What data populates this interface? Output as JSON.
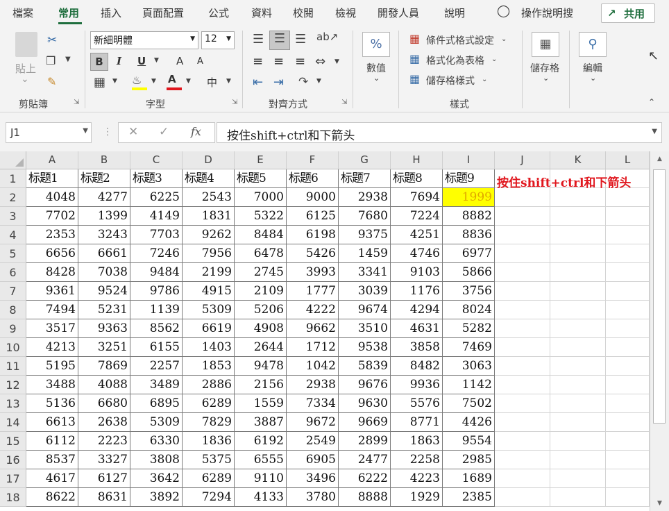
{
  "menu": {
    "tabs": [
      "檔案",
      "常用",
      "插入",
      "頁面配置",
      "公式",
      "資料",
      "校閱",
      "檢視",
      "開發人員",
      "說明"
    ],
    "active_tab": "常用",
    "search_label": "操作說明搜",
    "share_label": "共用"
  },
  "ribbon": {
    "clipboard": {
      "paste_label": "貼上",
      "group_label": "剪貼簿"
    },
    "font": {
      "font_name": "新細明體",
      "font_size": "12",
      "bold": "B",
      "italic": "I",
      "underline": "U",
      "grow": "A",
      "shrink": "A",
      "font_color_letter": "A",
      "phonetic": "中",
      "group_label": "字型"
    },
    "alignment": {
      "group_label": "對齊方式"
    },
    "number": {
      "label": "數值",
      "symbol": "%"
    },
    "styles": {
      "conditional": "條件式格式設定",
      "format_table": "格式化為表格",
      "cell_styles": "儲存格樣式",
      "group_label": "樣式"
    },
    "cells": {
      "label": "儲存格"
    },
    "editing": {
      "label": "編輯"
    }
  },
  "formula_bar": {
    "name_box": "J1",
    "fx": "fx",
    "content": "按住shift+ctrl和下箭头"
  },
  "sheet": {
    "columns": [
      "A",
      "B",
      "C",
      "D",
      "E",
      "F",
      "G",
      "H",
      "I",
      "J",
      "K",
      "L"
    ],
    "rows": [
      "1",
      "2",
      "3",
      "4",
      "5",
      "6",
      "7",
      "8",
      "9",
      "10",
      "11",
      "12",
      "13",
      "14",
      "15",
      "16",
      "17",
      "18"
    ],
    "headers": [
      "标题1",
      "标题2",
      "标题3",
      "标题4",
      "标题5",
      "标题6",
      "标题7",
      "标题8",
      "标题9"
    ],
    "note": "按住shift+ctrl和下箭头",
    "highlight_color": "#ffff00",
    "highlight_text_color": "#e0a800",
    "data": [
      [
        "4048",
        "4277",
        "6225",
        "2543",
        "7000",
        "9000",
        "2938",
        "7694",
        "1999"
      ],
      [
        "7702",
        "1399",
        "4149",
        "1831",
        "5322",
        "6125",
        "7680",
        "7224",
        "8882"
      ],
      [
        "2353",
        "3243",
        "7703",
        "9262",
        "8484",
        "6198",
        "9375",
        "4251",
        "8836"
      ],
      [
        "6656",
        "6661",
        "7246",
        "7956",
        "6478",
        "5426",
        "1459",
        "4746",
        "6977"
      ],
      [
        "8428",
        "7038",
        "9484",
        "2199",
        "2745",
        "3993",
        "3341",
        "9103",
        "5866"
      ],
      [
        "9361",
        "9524",
        "9786",
        "4915",
        "2109",
        "1777",
        "3039",
        "1176",
        "3756"
      ],
      [
        "7494",
        "5231",
        "1139",
        "5309",
        "5206",
        "4222",
        "9674",
        "4294",
        "8024"
      ],
      [
        "3517",
        "9363",
        "8562",
        "6619",
        "4908",
        "9662",
        "3510",
        "4631",
        "5282"
      ],
      [
        "4213",
        "3251",
        "6155",
        "1403",
        "2644",
        "1712",
        "9538",
        "3858",
        "7469"
      ],
      [
        "5195",
        "7869",
        "2257",
        "1853",
        "9478",
        "1042",
        "5839",
        "8482",
        "3063"
      ],
      [
        "3488",
        "4088",
        "3489",
        "2886",
        "2156",
        "2938",
        "9676",
        "9936",
        "1142"
      ],
      [
        "5136",
        "6680",
        "6895",
        "6289",
        "1559",
        "7334",
        "9630",
        "5576",
        "7502"
      ],
      [
        "6613",
        "2638",
        "5309",
        "7829",
        "3887",
        "9672",
        "9669",
        "8771",
        "4426"
      ],
      [
        "6112",
        "2223",
        "6330",
        "1836",
        "6192",
        "2549",
        "2899",
        "1863",
        "9554"
      ],
      [
        "8537",
        "3327",
        "3808",
        "5375",
        "6555",
        "6905",
        "2477",
        "2258",
        "2985"
      ],
      [
        "4617",
        "6127",
        "3642",
        "6289",
        "9110",
        "3496",
        "6222",
        "4223",
        "1689"
      ],
      [
        "8622",
        "8631",
        "3892",
        "7294",
        "4133",
        "3780",
        "8888",
        "1929",
        "2385"
      ]
    ]
  }
}
